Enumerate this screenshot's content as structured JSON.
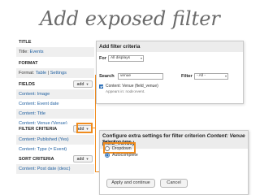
{
  "slide_title": "Add exposed filter",
  "views": {
    "title_section": "TITLE",
    "title_label": "Title:",
    "title_value": "Events",
    "format_section": "FORMAT",
    "format_label": "Format:",
    "format_table": "Table",
    "format_sep": "|",
    "format_settings": "Settings",
    "fields_section": "FIELDS",
    "fields_add": "add",
    "fields": [
      "Content: Image",
      "Content: Event date",
      "Content: Title",
      "Content: Venue (Venue)"
    ],
    "filter_section": "FILTER CRITERIA",
    "filter_add": "add",
    "filters": [
      "Content: Published (Yes)",
      "Content: Type (= Event)"
    ],
    "sort_section": "SORT CRITERIA",
    "sort_add": "add",
    "sorts": [
      "Content: Post date (desc)"
    ]
  },
  "add_filter_dialog": {
    "title": "Add filter criteria",
    "for_label": "For",
    "for_value": "All displays",
    "search_label": "Search",
    "search_value": "venue",
    "filter_label": "Filter",
    "filter_value": "- All -",
    "result_label": "Content: Venue (field_venue)",
    "result_desc": "Appears in: node:event."
  },
  "configure_dialog": {
    "title_prefix": "Configure extra settings for filter criterion",
    "title_italic": "Content: Venue",
    "title_line2": "(field_venue)",
    "selection_type_label": "Selection type",
    "options": [
      "Dropdown",
      "Autocomplete"
    ],
    "apply_button": "Apply and continue",
    "cancel_button": "Cancel"
  },
  "colors": {
    "highlight": "#f08c1e",
    "link": "#1f5fa0",
    "checkbox": "#2c6fb8"
  }
}
